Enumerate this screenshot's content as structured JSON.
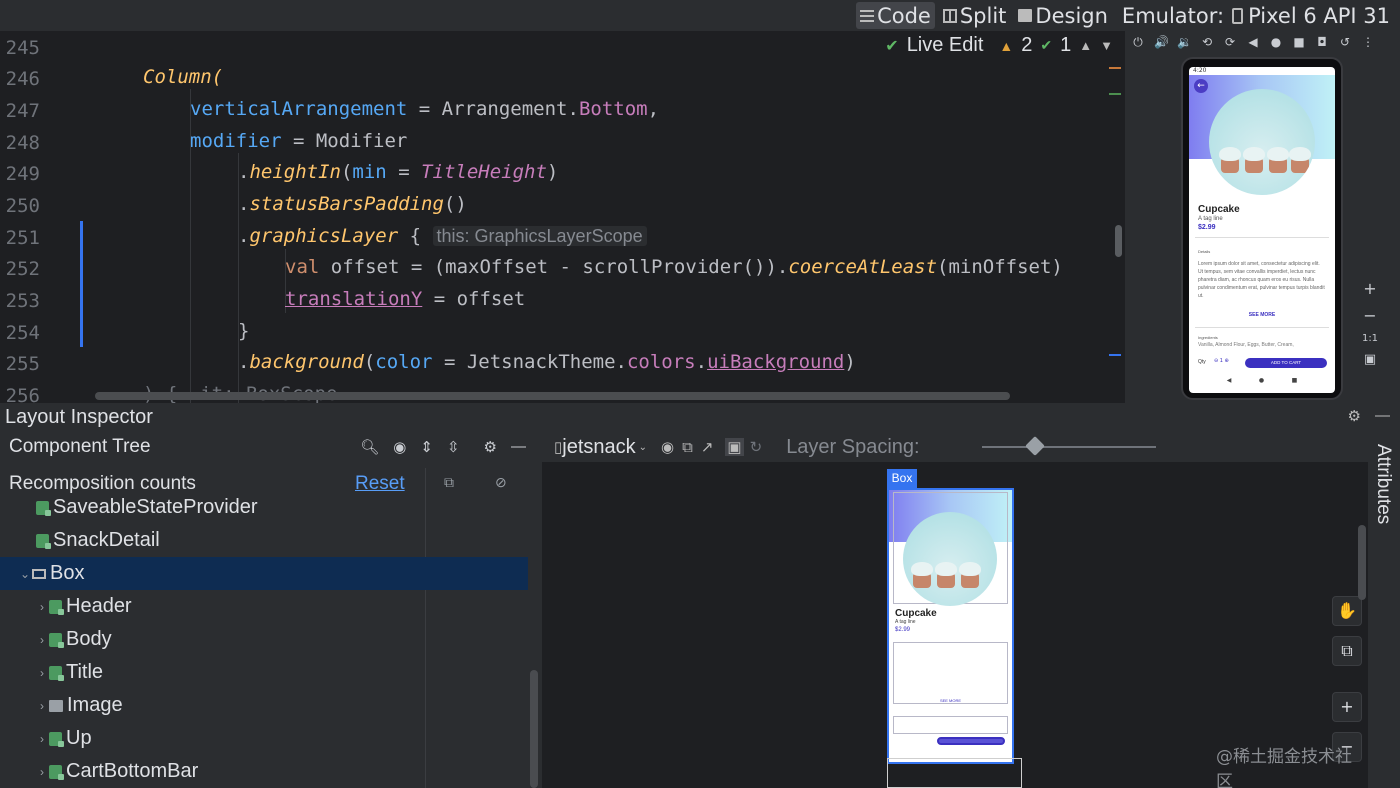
{
  "topbar": {
    "code_label": "Code",
    "split_label": "Split",
    "design_label": "Design",
    "emulator_label": "Emulator:",
    "device_label": "Pixel 6 API 31"
  },
  "editor": {
    "live_edit": "Live Edit",
    "warnings": "2",
    "ok_count": "1",
    "line_numbers": [
      "245",
      "246",
      "247",
      "248",
      "249",
      "250",
      "251",
      "252",
      "253",
      "254",
      "255",
      "256"
    ],
    "lines": {
      "l246": "Column(",
      "l247_prop": "verticalArrangement",
      "l247_eq": " = Arrangement.",
      "l247_val": "Bottom",
      "l247_end": ",",
      "l248_prop": "modifier",
      "l248_rest": " = Modifier",
      "l249_dot": ".",
      "l249_fn": "heightIn",
      "l249_p1": "(",
      "l249_arg": "min",
      "l249_eq": " = ",
      "l249_val": "TitleHeight",
      "l249_end": ")",
      "l250_dot": ".",
      "l250_fn": "statusBarsPadding",
      "l250_end": "()",
      "l251_dot": ".",
      "l251_fn": "graphicsLayer",
      "l251_brace": " { ",
      "l251_hint": "this: GraphicsLayerScope",
      "l252_kw": "val",
      "l252_rest": " offset = (maxOffset - scrollProvider()).",
      "l252_fn": "coerceAtLeast",
      "l252_end": "(minOffset)",
      "l253_prop": "translationY",
      "l253_rest": " = offset",
      "l254": "}",
      "l255_dot": ".",
      "l255_fn": "background",
      "l255_p1": "(",
      "l255_arg": "color",
      "l255_mid": " = JetsnackTheme.",
      "l255_colors": "colors",
      "l255_dot2": ".",
      "l255_ui": "uiBackground",
      "l255_end": ")",
      "l256": ") {  it: BoxScope"
    }
  },
  "emulator_screen": {
    "status_time": "4:20",
    "title": "Cupcake",
    "tagline": "A tag line",
    "price": "$2.99",
    "details_heading": "Details",
    "details_text": "Lorem ipsum dolor sit amet, consectetur adipiscing elit. Ut tempus, sem vitae convallis imperdiet, lectus nunc pharetra diam, ac rhoncus quam eros eu risus. Nulla pulvinar condimentum erat, pulvinar tempus turpis blandit ut.",
    "see_more": "SEE MORE",
    "ingredients_heading": "Ingredients",
    "ingredients_text": "Vanilla, Almond Flour, Eggs, Butter, Cream,",
    "qty_label": "Qty",
    "qty_value": "1",
    "add_to_cart": "ADD TO CART",
    "zoom_ratio": "1:1"
  },
  "layout_inspector": {
    "title": "Layout Inspector",
    "component_tree_label": "Component Tree",
    "recomposition_label": "Recomposition counts",
    "reset_label": "Reset",
    "process_label": "jetsnack",
    "layer_spacing_label": "Layer Spacing:",
    "attributes_label": "Attributes",
    "box_tag": "Box",
    "tree": [
      {
        "label": "SaveableStateProvider",
        "icon": "compose-icon"
      },
      {
        "label": "SnackDetail",
        "icon": "compose-icon"
      },
      {
        "label": "Box",
        "icon": "box-icon",
        "selected": true,
        "expanded": true
      },
      {
        "label": "Header",
        "icon": "compose-icon"
      },
      {
        "label": "Body",
        "icon": "compose-icon"
      },
      {
        "label": "Title",
        "icon": "compose-icon"
      },
      {
        "label": "Image",
        "icon": "image-icon"
      },
      {
        "label": "Up",
        "icon": "compose-icon"
      },
      {
        "label": "CartBottomBar",
        "icon": "compose-icon"
      }
    ],
    "preview": {
      "title": "Cupcake",
      "tagline": "A tag line",
      "price": "$2.99",
      "see_more": "SEE MORE"
    }
  },
  "watermark": "@稀土掘金技术社区",
  "colors": {
    "accent": "#3574f0",
    "selection": "#0e2c52",
    "brand_purple": "#3b30c0"
  }
}
